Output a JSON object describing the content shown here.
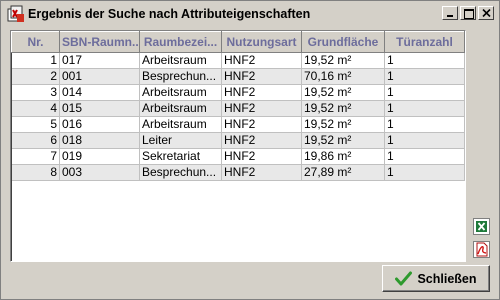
{
  "window": {
    "title": "Ergebnis der Suche nach Attributeigenschaften"
  },
  "table": {
    "columns": [
      "Nr.",
      "SBN-Raumn...",
      "Raumbezei...",
      "Nutzungsart",
      "Grundfläche",
      "Türanzahl"
    ],
    "rows": [
      [
        "1",
        "017",
        "Arbeitsraum",
        "HNF2",
        "19,52 m²",
        "1"
      ],
      [
        "2",
        "001",
        "Besprechun...",
        "HNF2",
        "70,16 m²",
        "1"
      ],
      [
        "3",
        "014",
        "Arbeitsraum",
        "HNF2",
        "19,52 m²",
        "1"
      ],
      [
        "4",
        "015",
        "Arbeitsraum",
        "HNF2",
        "19,52 m²",
        "1"
      ],
      [
        "5",
        "016",
        "Arbeitsraum",
        "HNF2",
        "19,52 m²",
        "1"
      ],
      [
        "6",
        "018",
        "Leiter",
        "HNF2",
        "19,52 m²",
        "1"
      ],
      [
        "7",
        "019",
        "Sekretariat",
        "HNF2",
        "19,86 m²",
        "1"
      ],
      [
        "8",
        "003",
        "Besprechun...",
        "HNF2",
        "27,89 m²",
        "1"
      ]
    ]
  },
  "side_icons": [
    "excel-export-icon",
    "pdf-export-icon"
  ],
  "buttons": {
    "close_label": "Schließen"
  },
  "colors": {
    "header_text": "#6d6d9c",
    "row_alt": "#e8e8e8",
    "check_green": "#2e9a2e"
  }
}
